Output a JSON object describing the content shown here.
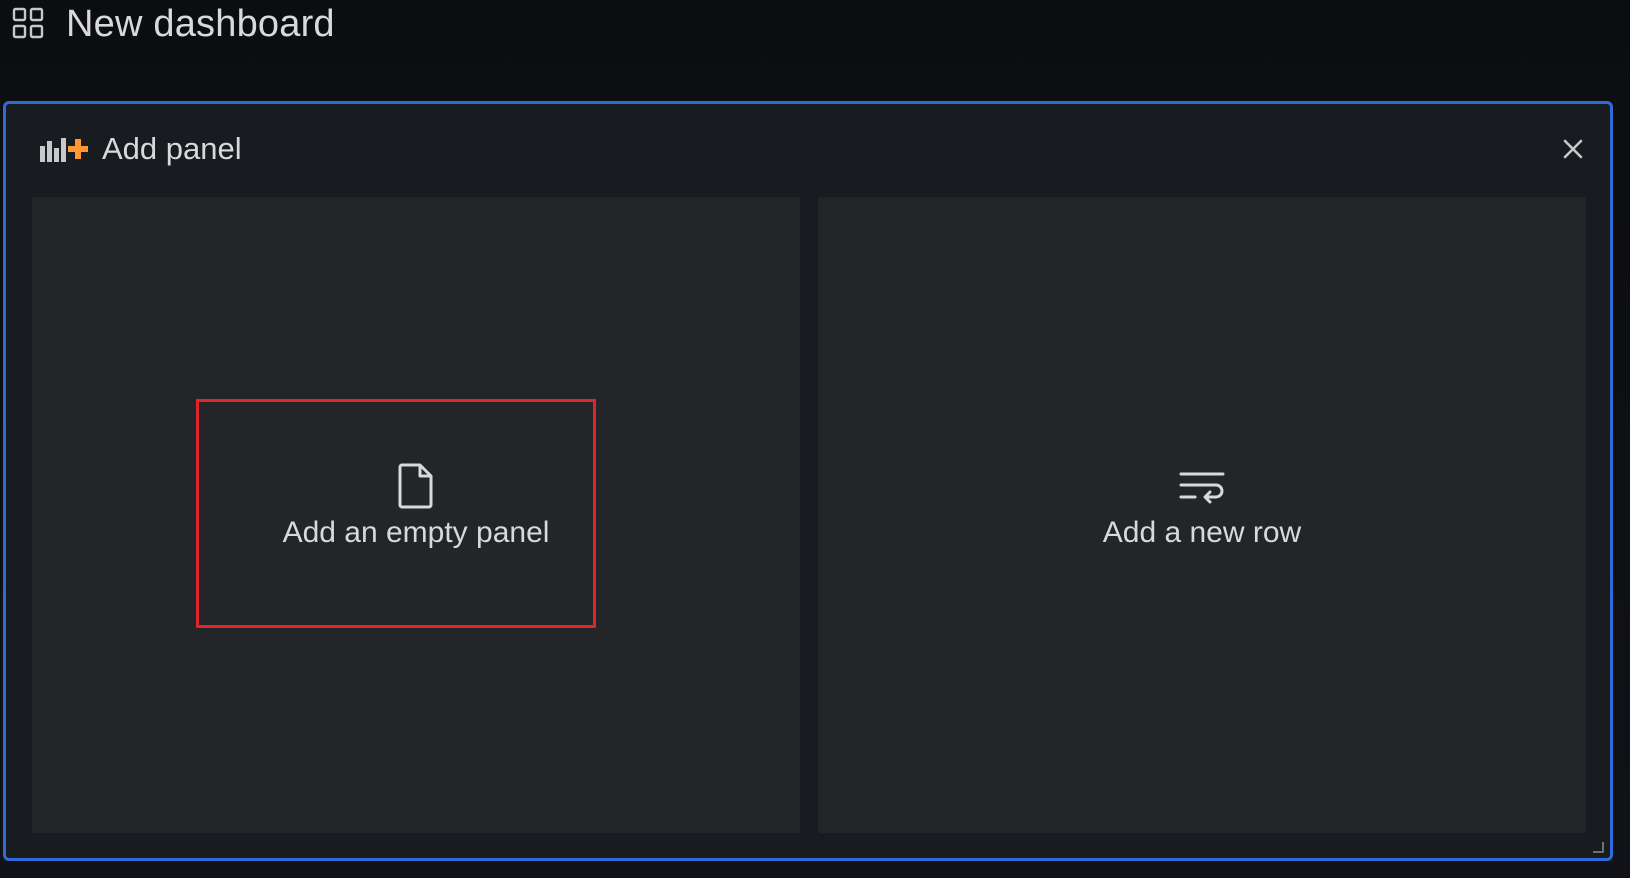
{
  "header": {
    "title": "New dashboard",
    "icon": "dashboard-grid-icon"
  },
  "add_panel": {
    "title": "Add panel",
    "header_icon": "add-panel-chart-icon",
    "close_icon": "close-icon",
    "options": [
      {
        "label": "Add an empty panel",
        "icon": "file-icon"
      },
      {
        "label": "Add a new row",
        "icon": "wrap-text-icon"
      }
    ]
  },
  "colors": {
    "background": "#111217",
    "panel_background": "#181b1f",
    "card_background": "#232529",
    "accent_border": "#2f6bd6",
    "highlight_red": "#e0262b",
    "icon_orange": "#ff9830",
    "text": "#d8d9da"
  }
}
